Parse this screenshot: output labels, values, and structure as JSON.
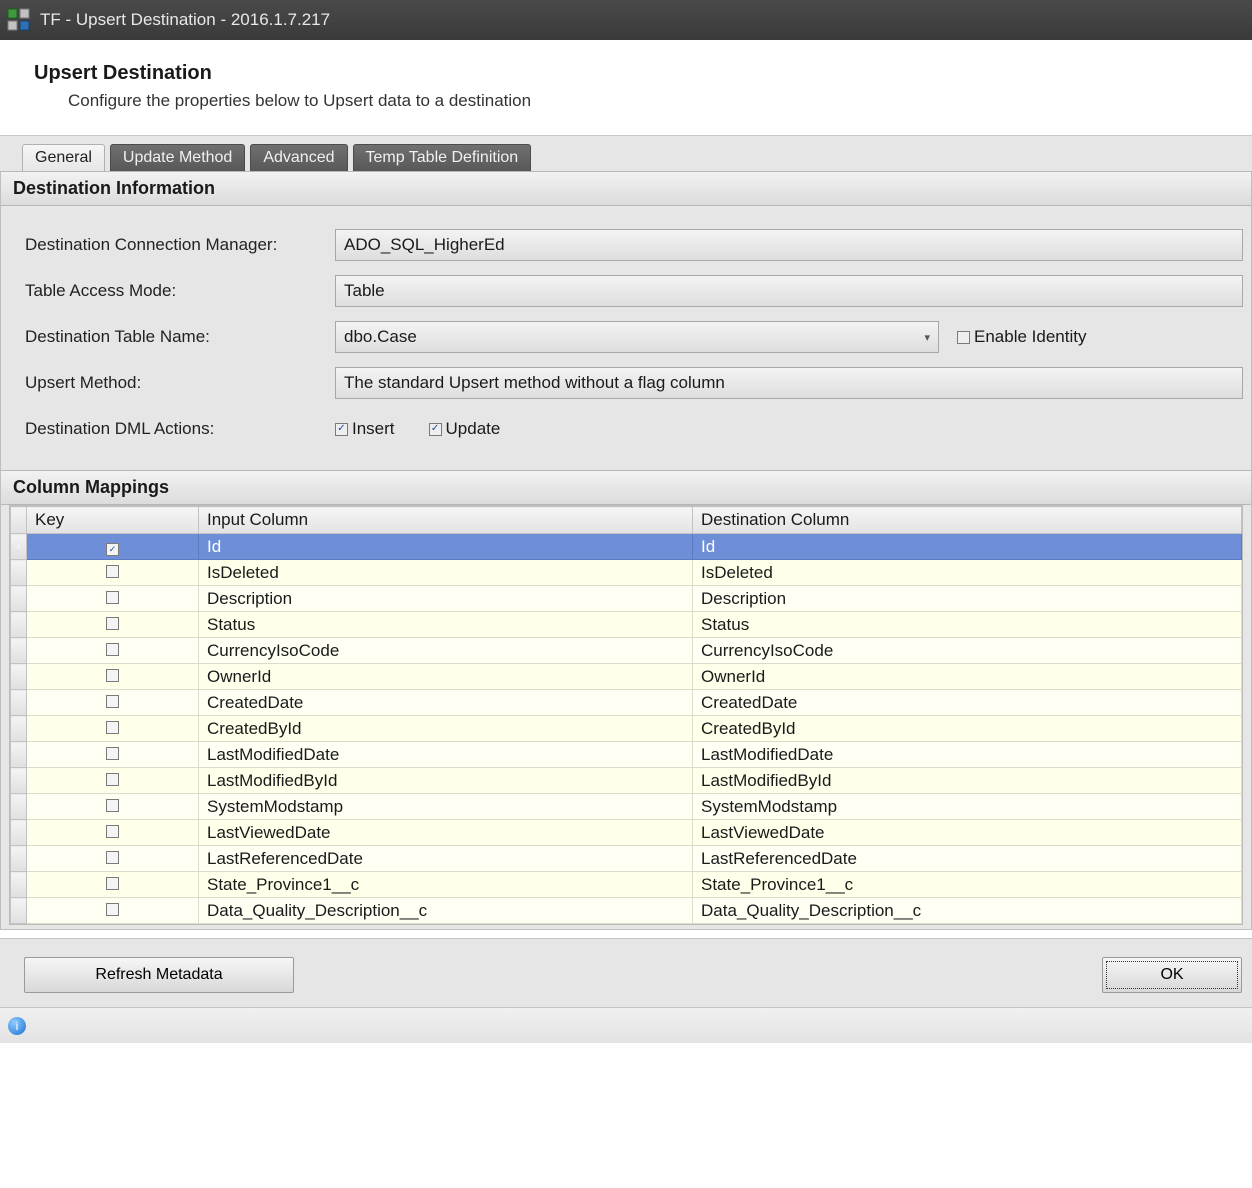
{
  "window": {
    "title": "TF - Upsert Destination - 2016.1.7.217"
  },
  "header": {
    "title": "Upsert Destination",
    "subtitle": "Configure the properties below to Upsert data to a destination"
  },
  "tabs": {
    "general": "General",
    "update": "Update Method",
    "advanced": "Advanced",
    "temp": "Temp Table Definition"
  },
  "dest": {
    "section_title": "Destination Information",
    "labels": {
      "conn": "Destination Connection Manager:",
      "mode": "Table Access Mode:",
      "table": "Destination Table Name:",
      "method": "Upsert Method:",
      "dml": "Destination DML Actions:"
    },
    "values": {
      "conn": "ADO_SQL_HigherEd",
      "mode": "Table",
      "table": "dbo.Case",
      "method": "The standard Upsert method without a flag column"
    },
    "enable_identity_label": "Enable Identity",
    "dml_insert_label": "Insert",
    "dml_update_label": "Update"
  },
  "mappings": {
    "section_title": "Column Mappings",
    "columns": {
      "key": "Key",
      "input": "Input Column",
      "dest": "Destination Column"
    },
    "rows": [
      {
        "key": true,
        "input": "Id",
        "dest": "Id",
        "selected": true
      },
      {
        "key": false,
        "input": "IsDeleted",
        "dest": "IsDeleted"
      },
      {
        "key": false,
        "input": "Description",
        "dest": "Description"
      },
      {
        "key": false,
        "input": "Status",
        "dest": "Status"
      },
      {
        "key": false,
        "input": "CurrencyIsoCode",
        "dest": "CurrencyIsoCode"
      },
      {
        "key": false,
        "input": "OwnerId",
        "dest": "OwnerId"
      },
      {
        "key": false,
        "input": "CreatedDate",
        "dest": "CreatedDate"
      },
      {
        "key": false,
        "input": "CreatedById",
        "dest": "CreatedById"
      },
      {
        "key": false,
        "input": "LastModifiedDate",
        "dest": "LastModifiedDate"
      },
      {
        "key": false,
        "input": "LastModifiedById",
        "dest": "LastModifiedById"
      },
      {
        "key": false,
        "input": "SystemModstamp",
        "dest": "SystemModstamp"
      },
      {
        "key": false,
        "input": "LastViewedDate",
        "dest": "LastViewedDate"
      },
      {
        "key": false,
        "input": "LastReferencedDate",
        "dest": "LastReferencedDate"
      },
      {
        "key": false,
        "input": "State_Province1__c",
        "dest": "State_Province1__c"
      },
      {
        "key": false,
        "input": "Data_Quality_Description__c",
        "dest": "Data_Quality_Description__c"
      }
    ]
  },
  "footer": {
    "refresh": "Refresh Metadata",
    "ok": "OK"
  }
}
